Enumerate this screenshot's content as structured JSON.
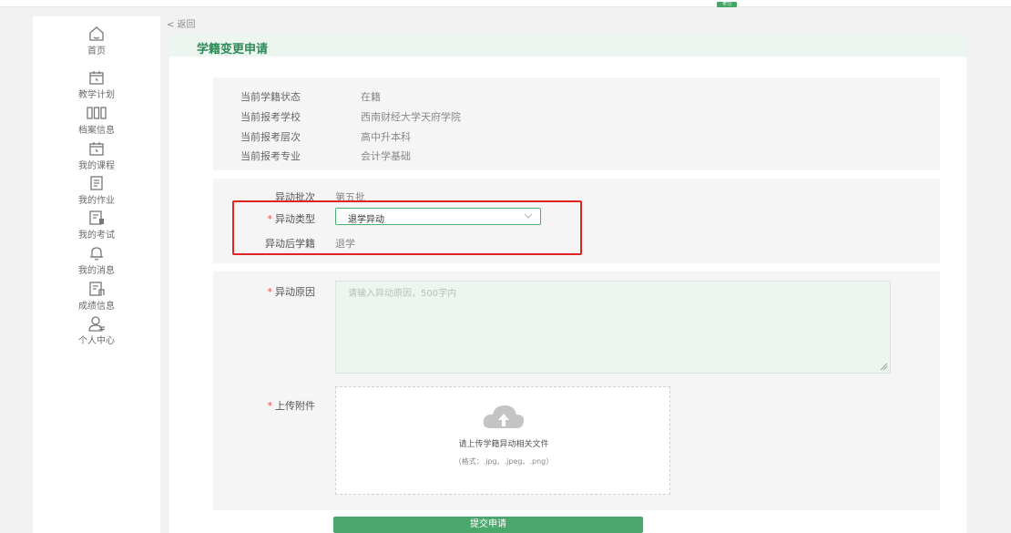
{
  "topbar": {
    "chip_label": "学习"
  },
  "sidebar": {
    "items": [
      {
        "label": "首页",
        "icon": "home-icon"
      },
      {
        "label": "教学计划",
        "icon": "calendar-icon"
      },
      {
        "label": "档案信息",
        "icon": "archive-icon"
      },
      {
        "label": "我的课程",
        "icon": "calendar-icon"
      },
      {
        "label": "我的作业",
        "icon": "document-icon"
      },
      {
        "label": "我的考试",
        "icon": "exam-icon"
      },
      {
        "label": "我的消息",
        "icon": "bell-icon"
      },
      {
        "label": "成绩信息",
        "icon": "score-icon"
      },
      {
        "label": "个人中心",
        "icon": "user-icon"
      }
    ]
  },
  "back_label": "< 返回",
  "page_title": "学籍变更申请",
  "status": {
    "rows": [
      {
        "key": "当前学籍状态",
        "value": "在籍"
      },
      {
        "key": "当前报考学校",
        "value": "西南财经大学天府学院"
      },
      {
        "key": "当前报考层次",
        "value": "高中升本科"
      },
      {
        "key": "当前报考专业",
        "value": "会计学基础"
      }
    ]
  },
  "change": {
    "batch_label": "异动批次",
    "batch_value": "第五批",
    "type_label": "异动类型",
    "type_value": "退学异动",
    "after_label": "异动后学籍",
    "after_value": "退学"
  },
  "reason": {
    "label": "异动原因",
    "placeholder": "请输入异动原因，500字内"
  },
  "upload": {
    "label": "上传附件",
    "hint": "请上传学籍异动相关文件",
    "formats": "（格式：.jpg、.jpeg、.png）"
  },
  "submit_label": "提交申请",
  "colors": {
    "accent": "#4aa86c",
    "highlight": "#e02424",
    "required": "#e74c3c"
  }
}
